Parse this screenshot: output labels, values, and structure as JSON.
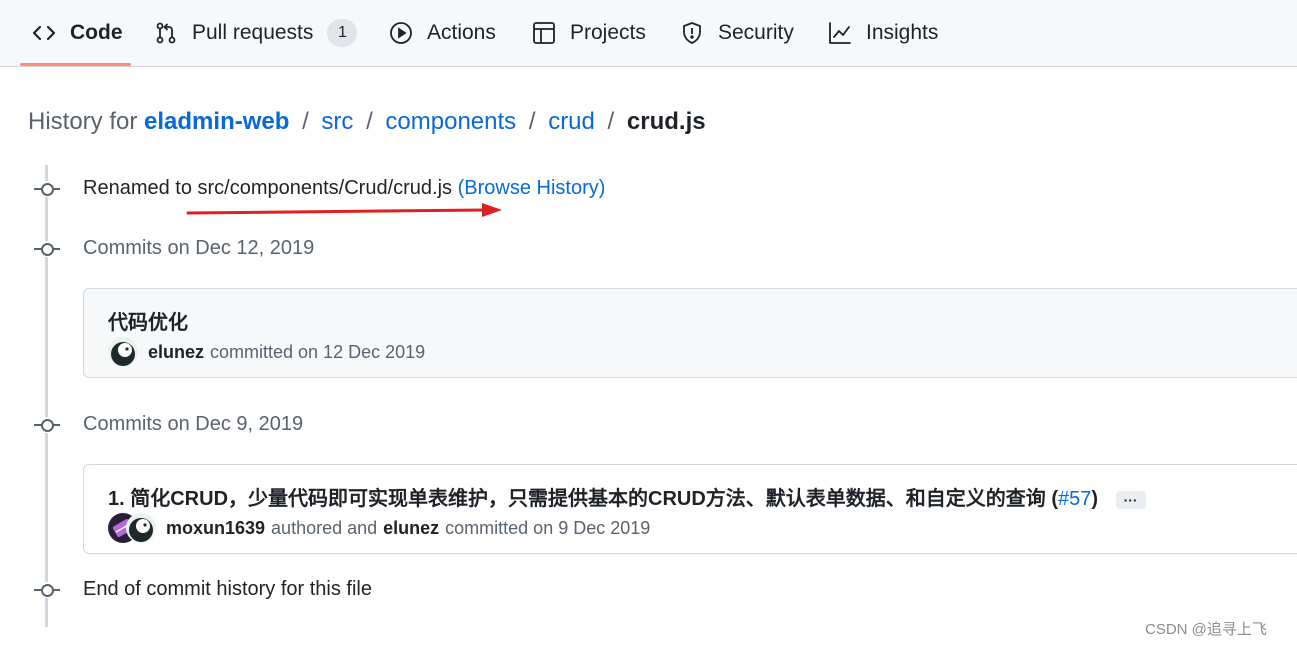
{
  "nav": {
    "tabs": [
      {
        "label": "Code",
        "icon": "code-icon",
        "active": true
      },
      {
        "label": "Pull requests",
        "icon": "git-pull-request-icon",
        "counter": "1"
      },
      {
        "label": "Actions",
        "icon": "play-icon"
      },
      {
        "label": "Projects",
        "icon": "table-icon"
      },
      {
        "label": "Security",
        "icon": "shield-icon"
      },
      {
        "label": "Insights",
        "icon": "graph-icon"
      }
    ],
    "active_underline_color": "#fd8c73"
  },
  "breadcrumb": {
    "prefix": "History for",
    "repo": "eladmin-web",
    "sep": "/",
    "path": [
      "src",
      "components",
      "crud"
    ],
    "file": "crud.js"
  },
  "timeline": {
    "renamed": {
      "text": "Renamed to src/components/Crud/crud.js",
      "link": "(Browse History)"
    },
    "groups": [
      {
        "date_label": "Commits on Dec 12, 2019",
        "commit": {
          "title": "代码优化",
          "author": "elunez",
          "action": "committed on 12 Dec 2019"
        }
      },
      {
        "date_label": "Commits on Dec 9, 2019",
        "commit": {
          "title": "1. 简化CRUD，少量代码即可实现单表维护，只需提供基本的CRUD方法、默认表单数据、和自定义的查询 (",
          "pr_link": "#57",
          "title_close": ")",
          "more": "···",
          "author": "moxun1639",
          "authored_text": "authored and",
          "committer": "elunez",
          "action": "committed on 9 Dec 2019"
        }
      }
    ],
    "end": "End of commit history for this file"
  },
  "colors": {
    "link": "#0969da",
    "annotation_arrow": "#e02020"
  },
  "watermark": "CSDN @追寻上飞"
}
